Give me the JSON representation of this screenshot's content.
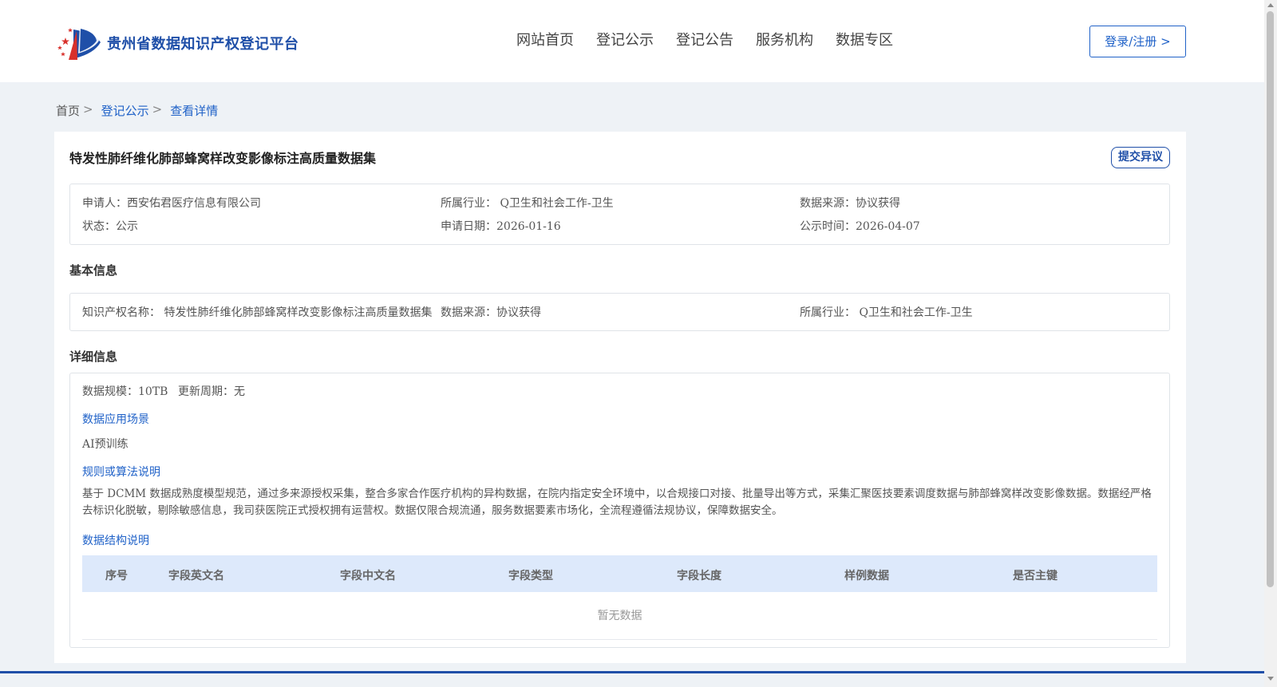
{
  "header": {
    "site_name": "贵州省数据知识产权登记平台",
    "logo_icon": "emblem-logo-icon",
    "nav": [
      "网站首页",
      "登记公示",
      "登记公告",
      "服务机构",
      "数据专区"
    ],
    "login_label": "登录/注册 >"
  },
  "breadcrumb": {
    "items": [
      "首页",
      "登记公示",
      "查看详情"
    ],
    "separator": ">"
  },
  "detail": {
    "title": "特发性肺纤维化肺部蜂窝样改变影像标注高质量数据集",
    "objection_label": "提交异议",
    "summary": {
      "applicant": "申请人：西安佑君医疗信息有限公司",
      "industry": "所属行业： Q卫生和社会工作-卫生",
      "data_source": "数据来源：协议获得",
      "status": "状态：公示",
      "apply_date": "申请日期：2026-01-16",
      "publish_time": "公示时间：2026-04-07"
    },
    "basic_title": "基本信息",
    "basic": {
      "ip_name": "知识产权名称： 特发性肺纤维化肺部蜂窝样改变影像标注高质量数据集",
      "data_source": "数据来源：协议获得",
      "industry": "所属行业： Q卫生和社会工作-卫生"
    },
    "detail_title": "详细信息",
    "scale": "数据规模：10TB",
    "update_cycle": "更新周期：无",
    "scenario_title": "数据应用场景",
    "scenario_text": "AI预训练",
    "rule_title": "规则或算法说明",
    "rule_text": "基于 DCMM 数据成熟度模型规范，通过多来源授权采集，整合多家合作医疗机构的异构数据，在院内指定安全环境中，以合规接口对接、批量导出等方式，采集汇聚医技要素调度数据与肺部蜂窝样改变影像数据。数据经严格去标识化脱敏，剔除敏感信息，我司获医院正式授权拥有运营权。数据仅限合规流通，服务数据要素市场化，全流程遵循法规协议，保障数据安全。",
    "structure_title": "数据结构说明",
    "table": {
      "headers": [
        "序号",
        "字段英文名",
        "字段中文名",
        "字段类型",
        "字段长度",
        "样例数据",
        "是否主键"
      ],
      "empty_text": "暂无数据"
    }
  },
  "colors": {
    "brand": "#1f4fa8",
    "link": "#2062c8",
    "table_header_bg": "#dde9fb",
    "page_bg": "#eef2f6"
  }
}
